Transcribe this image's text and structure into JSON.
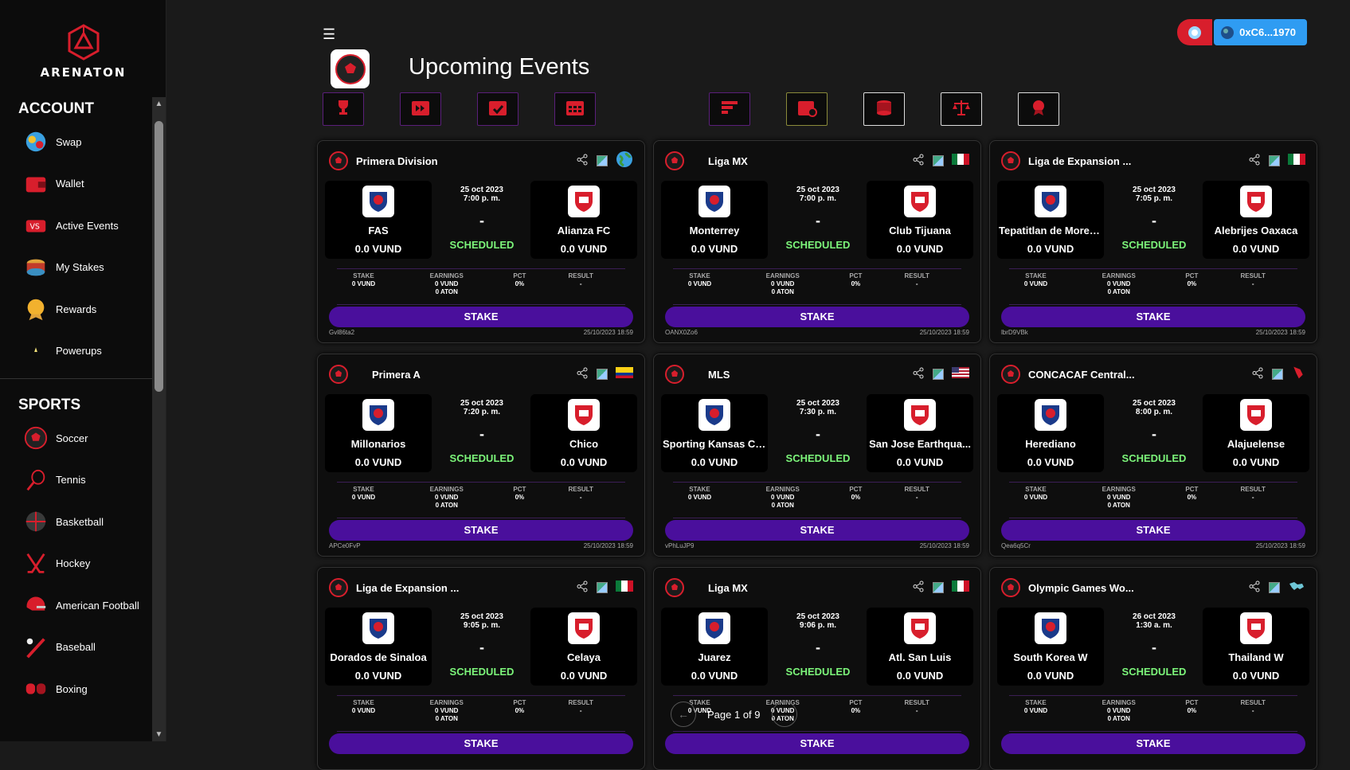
{
  "brand": {
    "name": "ARENATON"
  },
  "sidebar": {
    "account_title": "ACCOUNT",
    "account_items": [
      {
        "label": "Swap",
        "icon": "swap-icon"
      },
      {
        "label": "Wallet",
        "icon": "wallet-icon"
      },
      {
        "label": "Active Events",
        "icon": "active-events-icon"
      },
      {
        "label": "My Stakes",
        "icon": "stakes-icon"
      },
      {
        "label": "Rewards",
        "icon": "medal-icon"
      },
      {
        "label": "Powerups",
        "icon": "powerups-icon"
      }
    ],
    "sports_title": "SPORTS",
    "sports_items": [
      {
        "label": "Soccer",
        "icon": "soccer-icon"
      },
      {
        "label": "Tennis",
        "icon": "tennis-icon"
      },
      {
        "label": "Basketball",
        "icon": "basketball-icon"
      },
      {
        "label": "Hockey",
        "icon": "hockey-icon"
      },
      {
        "label": "American Football",
        "icon": "football-helmet-icon"
      },
      {
        "label": "Baseball",
        "icon": "baseball-icon"
      },
      {
        "label": "Boxing",
        "icon": "boxing-icon"
      }
    ]
  },
  "header": {
    "title": "Upcoming Events",
    "wallet_address": "0xC6...1970"
  },
  "filters": [
    "trophy-icon",
    "fast-forward-calendar-icon",
    "calendar-check-icon",
    "calendar-grid-icon",
    "sort-icon",
    "calendar-settings-icon",
    "coin-stack-icon",
    "scales-icon",
    "badge-icon"
  ],
  "labels": {
    "stake": "STAKE",
    "earnings": "EARNINGS",
    "pct": "PCT",
    "result": "RESULT",
    "stake_button": "STAKE",
    "separator": "-"
  },
  "colors": {
    "accent_purple": "#4a0f9c",
    "status_green": "#7cf57a",
    "brand_red": "#d81e2c",
    "wallet_blue": "#2f9cf2"
  },
  "events": [
    {
      "league": "Primera Division",
      "flag": "globe",
      "date": "25 oct 2023",
      "time": "7:00 p. m.",
      "home": "FAS",
      "away": "Alianza FC",
      "home_vund": "0.0 VUND",
      "away_vund": "0.0 VUND",
      "status": "SCHEDULED",
      "stake": "0 VUND",
      "earn1": "0 VUND",
      "earn2": "0 ATON",
      "pct": "0%",
      "result": "-",
      "id": "Gvl86ta2",
      "updated": "25/10/2023 18:59"
    },
    {
      "league": "Liga MX",
      "flag": "mx",
      "date": "25 oct 2023",
      "time": "7:00 p. m.",
      "home": "Monterrey",
      "away": "Club Tijuana",
      "home_vund": "0.0 VUND",
      "away_vund": "0.0 VUND",
      "status": "SCHEDULED",
      "stake": "0 VUND",
      "earn1": "0 VUND",
      "earn2": "0 ATON",
      "pct": "0%",
      "result": "-",
      "id": "OANX0Zo6",
      "updated": "25/10/2023 18:59"
    },
    {
      "league": "Liga de Expansion ...",
      "flag": "mx",
      "date": "25 oct 2023",
      "time": "7:05 p. m.",
      "home": "Tepatitlan de Morelos",
      "away": "Alebrijes Oaxaca",
      "home_vund": "0.0 VUND",
      "away_vund": "0.0 VUND",
      "status": "SCHEDULED",
      "stake": "0 VUND",
      "earn1": "0 VUND",
      "earn2": "0 ATON",
      "pct": "0%",
      "result": "-",
      "id": "lbrD9VBk",
      "updated": "25/10/2023 18:59"
    },
    {
      "league": "Primera A",
      "flag": "co",
      "date": "25 oct 2023",
      "time": "7:20 p. m.",
      "home": "Millonarios",
      "away": "Chico",
      "home_vund": "0.0 VUND",
      "away_vund": "0.0 VUND",
      "status": "SCHEDULED",
      "stake": "0 VUND",
      "earn1": "0 VUND",
      "earn2": "0 ATON",
      "pct": "0%",
      "result": "-",
      "id": "APCe0FvP",
      "updated": "25/10/2023 18:59"
    },
    {
      "league": "MLS",
      "flag": "us",
      "date": "25 oct 2023",
      "time": "7:30 p. m.",
      "home": "Sporting Kansas City",
      "away": "San Jose Earthqua...",
      "home_vund": "0.0 VUND",
      "away_vund": "0.0 VUND",
      "status": "SCHEDULED",
      "stake": "0 VUND",
      "earn1": "0 VUND",
      "earn2": "0 ATON",
      "pct": "0%",
      "result": "-",
      "id": "vPhLuJP9",
      "updated": "25/10/2023 18:59"
    },
    {
      "league": "CONCACAF Central...",
      "flag": "region",
      "date": "25 oct 2023",
      "time": "8:00 p. m.",
      "home": "Herediano",
      "away": "Alajuelense",
      "home_vund": "0.0 VUND",
      "away_vund": "0.0 VUND",
      "status": "SCHEDULED",
      "stake": "0 VUND",
      "earn1": "0 VUND",
      "earn2": "0 ATON",
      "pct": "0%",
      "result": "-",
      "id": "Qea6q5Cr",
      "updated": "25/10/2023 18:59"
    },
    {
      "league": "Liga de Expansion ...",
      "flag": "mx",
      "date": "25 oct 2023",
      "time": "9:05 p. m.",
      "home": "Dorados de Sinaloa",
      "away": "Celaya",
      "home_vund": "0.0 VUND",
      "away_vund": "0.0 VUND",
      "status": "SCHEDULED",
      "stake": "0 VUND",
      "earn1": "0 VUND",
      "earn2": "0 ATON",
      "pct": "0%",
      "result": "-",
      "id": "",
      "updated": ""
    },
    {
      "league": "Liga MX",
      "flag": "mx",
      "date": "25 oct 2023",
      "time": "9:06 p. m.",
      "home": "Juarez",
      "away": "Atl. San Luis",
      "home_vund": "0.0 VUND",
      "away_vund": "0.0 VUND",
      "status": "SCHEDULED",
      "stake": "0 VUND",
      "earn1": "0 VUND",
      "earn2": "0 ATON",
      "pct": "0%",
      "result": "-",
      "id": "",
      "updated": ""
    },
    {
      "league": "Olympic Games Wo...",
      "flag": "world",
      "date": "26 oct 2023",
      "time": "1:30 a. m.",
      "home": "South Korea W",
      "away": "Thailand W",
      "home_vund": "0.0 VUND",
      "away_vund": "0.0 VUND",
      "status": "SCHEDULED",
      "stake": "0 VUND",
      "earn1": "0 VUND",
      "earn2": "0 ATON",
      "pct": "0%",
      "result": "-",
      "id": "",
      "updated": ""
    }
  ],
  "pagination": {
    "text": "Page 1 of 9"
  }
}
